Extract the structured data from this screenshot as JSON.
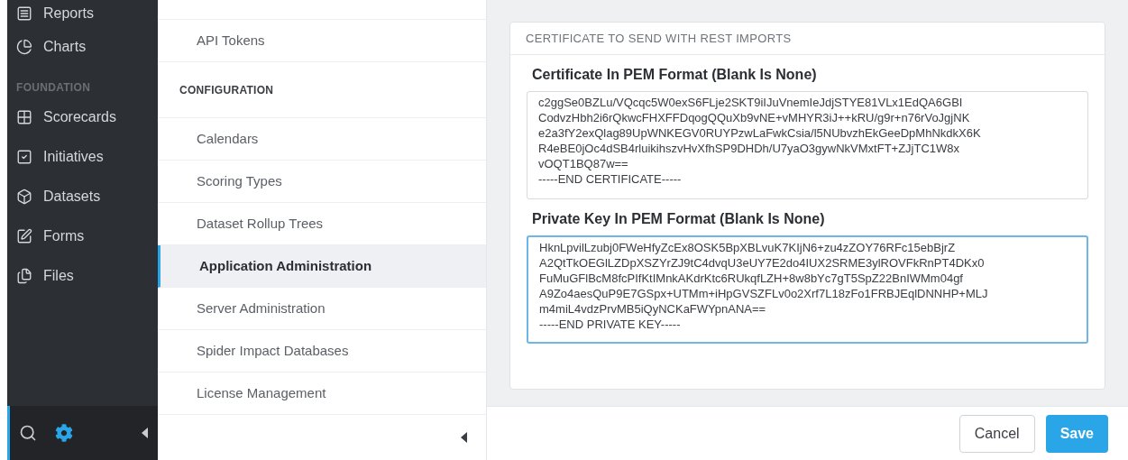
{
  "sidebar": {
    "groups": [
      {
        "items": [
          {
            "label": "Reports"
          },
          {
            "label": "Charts"
          }
        ]
      },
      {
        "heading": "FOUNDATION",
        "items": [
          {
            "label": "Scorecards"
          },
          {
            "label": "Initiatives"
          },
          {
            "label": "Datasets"
          },
          {
            "label": "Forms"
          },
          {
            "label": "Files"
          }
        ]
      }
    ],
    "toolbar": [
      {
        "kind": "search",
        "selected": false
      },
      {
        "kind": "settings",
        "selected": true
      }
    ]
  },
  "settings_nav": {
    "items": [
      {
        "kind": "item",
        "label": "API Tokens",
        "selected": false
      },
      {
        "kind": "heading",
        "label": "CONFIGURATION"
      },
      {
        "kind": "item",
        "label": "Calendars",
        "selected": false
      },
      {
        "kind": "item",
        "label": "Scoring Types",
        "selected": false
      },
      {
        "kind": "item",
        "label": "Dataset Rollup Trees",
        "selected": false
      },
      {
        "kind": "item",
        "label": "Application Administration",
        "selected": true
      },
      {
        "kind": "item",
        "label": "Server Administration",
        "selected": false
      },
      {
        "kind": "item",
        "label": "Spider Impact Databases",
        "selected": false
      },
      {
        "kind": "item",
        "label": "License Management",
        "selected": false
      }
    ]
  },
  "card": {
    "title": "CERTIFICATE TO SEND WITH REST IMPORTS",
    "fields": [
      {
        "label": "Certificate In PEM Format (Blank Is None)",
        "focused": false,
        "lines": [
          "c2ggSe0BZLu/VQcqc5W0exS6FLje2SKT9iIJuVnemIeJdjSTYE81VLx1EdQA6GBI",
          "CodvzHbh2i6rQkwcFHXFFDqogQQuXb9vNE+vMHYR3iJ++kRU/g9r+n76rVoJgjNK",
          "e2a3fY2exQlag89UpWNKEGV0RUYPzwLaFwkCsia/l5NUbvzhEkGeeDpMhNkdkX6K",
          "R4eBE0jOc4dSB4rluikihszvHvXfhSP9DHDh/U7yaO3gywNkVMxtFT+ZJjTC1W8x",
          "vOQT1BQ87w==",
          "-----END CERTIFICATE-----"
        ]
      },
      {
        "label": "Private Key In PEM Format (Blank Is None)",
        "focused": true,
        "lines": [
          "HknLpvilLzubj0FWeHfyZcEx8OSK5BpXBLvuK7KIjN6+zu4zZOY76RFc15ebBjrZ",
          "A2QtTkOEGlLZDpXSZYrZJ9tC4dvqU3eUY7E2do4IUX2SRME3ylROVFkRnPT4DKx0",
          "FuMuGFlBcM8fcPIfKtIMnkAKdrKtc6RUkqfLZH+8w8bYc7gT5SpZ22BnIWMm04gf",
          "A9Zo4aesQuP9E7GSpx+UTMm+iHpGVSZFLv0o2Xrf7L18zFo1FRBJEqlDNNHP+MLJ",
          "m4miL4vdzPrvMB5iQyNCKaFWYpnANA==",
          "-----END PRIVATE KEY-----"
        ]
      }
    ]
  },
  "footer": {
    "buttons": [
      {
        "label": "Cancel",
        "kind": "secondary"
      },
      {
        "label": "Save",
        "kind": "primary"
      }
    ]
  }
}
